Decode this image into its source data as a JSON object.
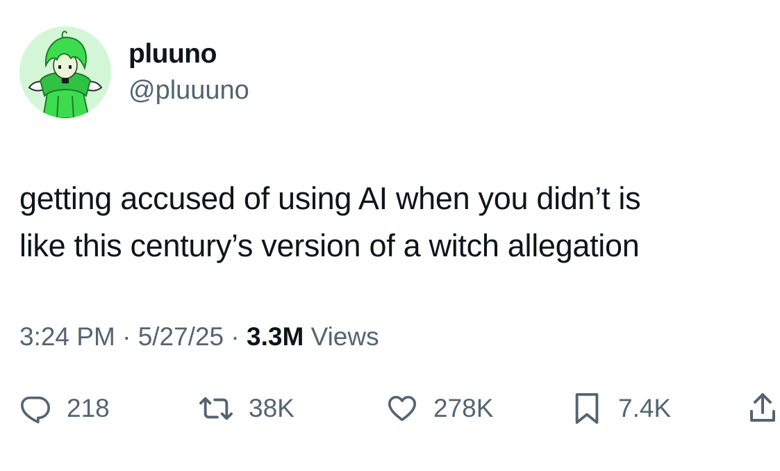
{
  "author": {
    "display_name": "pluuno",
    "handle": "@pluuuno"
  },
  "tweet": {
    "lines": [
      "getting accused of using AI when you didn’t is",
      "like this century’s version of a witch allegation"
    ]
  },
  "meta": {
    "time": "3:24 PM",
    "separator": "·",
    "date": "5/27/25",
    "views_count": "3.3M",
    "views_label": "Views"
  },
  "actions": {
    "replies": "218",
    "retweets": "38K",
    "likes": "278K",
    "bookmarks": "7.4K"
  },
  "icons": {
    "reply": "reply-icon",
    "retweet": "retweet-icon",
    "like": "heart-icon",
    "bookmark": "bookmark-icon",
    "share": "share-icon"
  },
  "colors": {
    "text_primary": "#0f1419",
    "text_secondary": "#536471",
    "avatar_bg": "#d3f7d6",
    "avatar_green": "#3ddc4e"
  }
}
